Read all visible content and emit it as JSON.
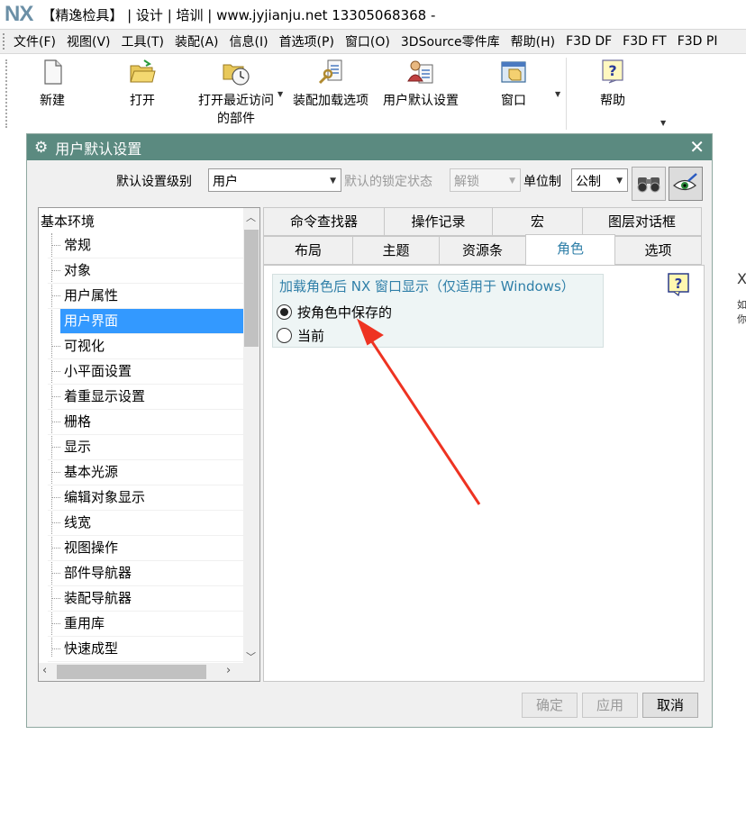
{
  "title_bar": {
    "logo": "NX",
    "title": "【精逸检具】 | 设计 | 培训 | www.jyjianju.net  13305068368 -"
  },
  "menubar": {
    "items": [
      "文件(F)",
      "视图(V)",
      "工具(T)",
      "装配(A)",
      "信息(I)",
      "首选项(P)",
      "窗口(O)",
      "3DSource零件库",
      "帮助(H)",
      "F3D DF",
      "F3D FT",
      "F3D PI"
    ]
  },
  "ribbon": {
    "buttons": [
      {
        "label": "新建",
        "icon": "new-file-icon"
      },
      {
        "label": "打开",
        "icon": "open-folder-icon"
      },
      {
        "label": "打开最近访问",
        "label2": "的部件",
        "icon": "recent-parts-icon"
      },
      {
        "label": "装配加载选项",
        "icon": "assembly-load-options-icon"
      },
      {
        "label": "用户默认设置",
        "icon": "user-defaults-icon"
      },
      {
        "label": "窗口",
        "icon": "window-icon"
      },
      {
        "label": "帮助",
        "icon": "help-icon"
      }
    ]
  },
  "dialog": {
    "title": "用户默认设置",
    "close_symbol": "✕",
    "settings_level_label": "默认设置级别",
    "settings_level_value": "用户",
    "lock_status_label": "默认的锁定状态",
    "lock_status_value": "解锁",
    "units_label": "单位制",
    "units_value": "公制",
    "tree": {
      "root": "基本环境",
      "items": [
        "常规",
        "对象",
        "用户属性",
        "用户界面",
        "可视化",
        "小平面设置",
        "着重显示设置",
        "栅格",
        "显示",
        "基本光源",
        "编辑对象显示",
        "线宽",
        "视图操作",
        "部件导航器",
        "装配导航器",
        "重用库",
        "快速成型"
      ],
      "selected": "用户界面"
    },
    "tabs_row1": [
      "命令查找器",
      "操作记录",
      "宏",
      "图层对话框"
    ],
    "tabs_row2": [
      "布局",
      "主题",
      "资源条",
      "角色",
      "选项"
    ],
    "active_tab": "角色",
    "group": {
      "title": "加载角色后 NX 窗口显示（仅适用于 Windows）",
      "options": [
        {
          "label": "按角色中保存的",
          "checked": true
        },
        {
          "label": "当前",
          "checked": false
        }
      ]
    },
    "buttons": {
      "ok": "确定",
      "apply": "应用",
      "cancel": "取消"
    }
  },
  "edge_text": {
    "line1": "X",
    "line2": "如",
    "line3": "你"
  },
  "colors": {
    "dialog_title_bg": "#5b8a80",
    "selection": "#3399ff",
    "group_title": "#2f7fa8",
    "annotation_arrow": "#ee3322"
  }
}
